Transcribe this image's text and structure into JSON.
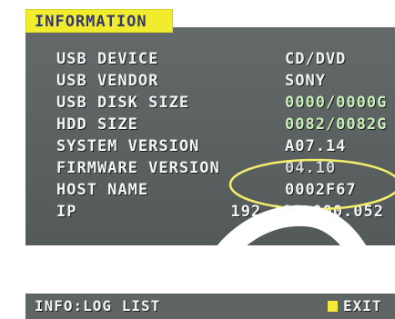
{
  "title": "INFORMATION",
  "rows": [
    {
      "label": "USB DEVICE",
      "value": "CD/DVD"
    },
    {
      "label": "USB VENDOR",
      "value": "SONY"
    },
    {
      "label": "USB DISK SIZE",
      "value": "0000/0000G"
    },
    {
      "label": "HDD SIZE",
      "value": "0082/0082G"
    },
    {
      "label": "SYSTEM VERSION",
      "value": "A07.14"
    },
    {
      "label": "FIRMWARE VERSION",
      "value": "04.10"
    },
    {
      "label": "HOST NAME",
      "value": "0002F67"
    },
    {
      "label": "IP",
      "value": "192.168.000.052"
    }
  ],
  "footer": {
    "left": "INFO:LOG LIST",
    "exit": "EXIT"
  },
  "colors": {
    "title_bg": "#f2ec2e",
    "panel_bg": "#5f6565",
    "highlight": "#f3ef6b",
    "exit_key": "#f4e83a"
  }
}
